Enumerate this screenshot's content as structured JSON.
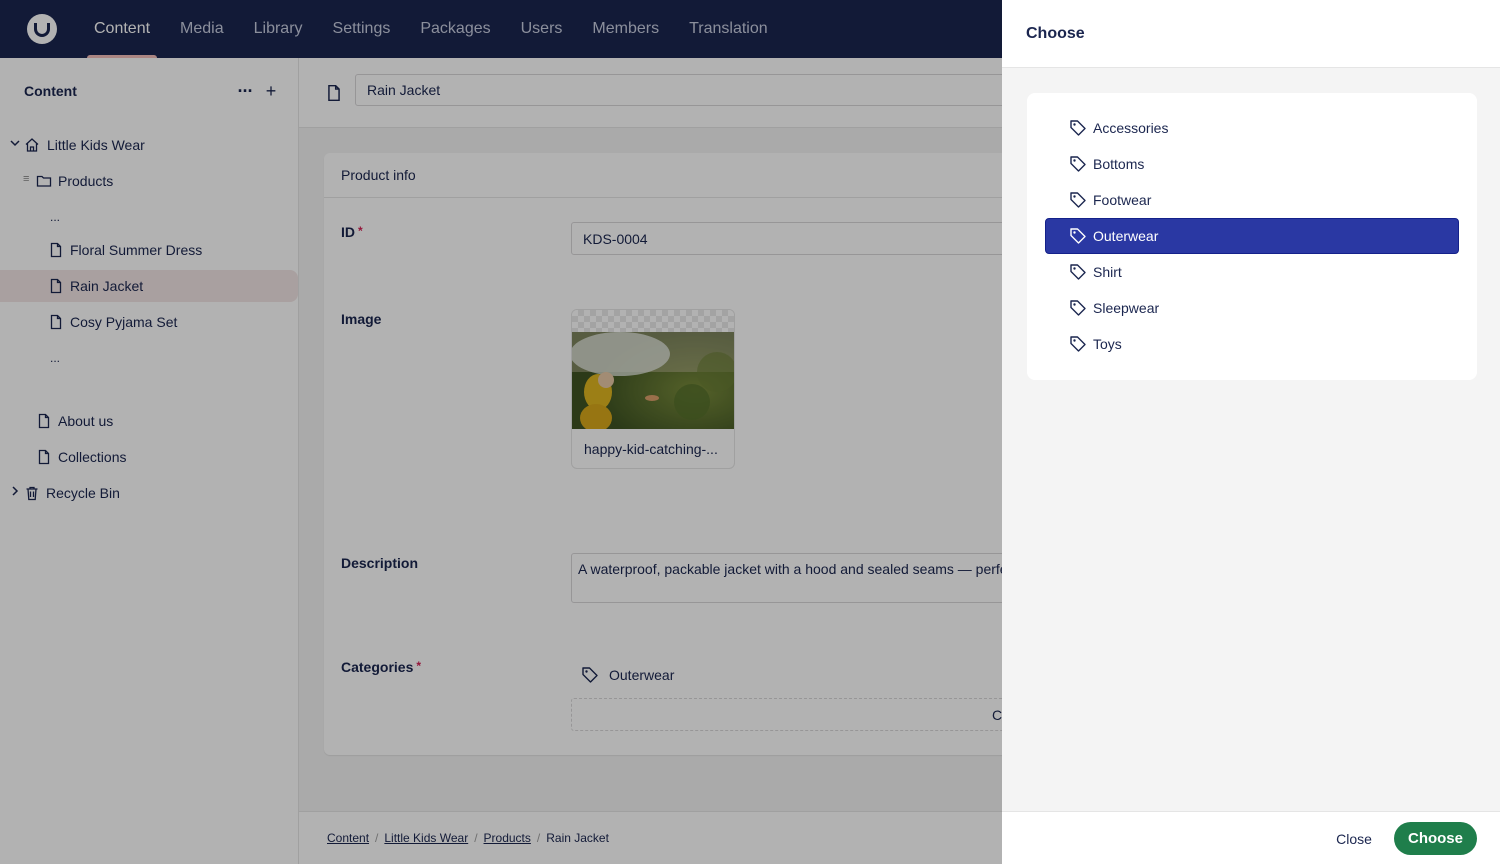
{
  "header": {
    "nav": [
      "Content",
      "Media",
      "Library",
      "Settings",
      "Packages",
      "Users",
      "Members",
      "Translation"
    ],
    "active": "Content"
  },
  "sidebar": {
    "title": "Content",
    "more_label": "···",
    "add_label": "+",
    "items": [
      {
        "label": "Little Kids Wear"
      },
      {
        "label": "Products"
      },
      {
        "label": "..."
      },
      {
        "label": "Floral Summer Dress"
      },
      {
        "label": "Rain Jacket"
      },
      {
        "label": "Cosy Pyjama Set"
      },
      {
        "label": "..."
      },
      {
        "label": "About us"
      },
      {
        "label": "Collections"
      },
      {
        "label": "Recycle Bin"
      }
    ]
  },
  "workspace": {
    "name": "Rain Jacket",
    "group_title": "Product info",
    "id_label": "ID",
    "id_value": "KDS-0004",
    "image_label": "Image",
    "image_name": "happy-kid-catching-...",
    "description_label": "Description",
    "description_value": "A waterproof, packable jacket with a hood and sealed seams — perfec",
    "categories_label": "Categories",
    "categories_selected": "Outerwear",
    "categories_button_partial": "C",
    "required_mark": "*"
  },
  "breadcrumbs": [
    "Content",
    "Little Kids Wear",
    "Products",
    "Rain Jacket"
  ],
  "modal": {
    "title": "Choose",
    "options": [
      "Accessories",
      "Bottoms",
      "Footwear",
      "Outerwear",
      "Shirt",
      "Sleepwear",
      "Toys"
    ],
    "selected": "Outerwear",
    "close_label": "Close",
    "choose_label": "Choose"
  },
  "colors": {
    "header_bg": "#1b264f",
    "selected_option": "#2a38a3",
    "choose_button": "#1f7e4b",
    "active_tab_indicator": "#f5c1bc"
  }
}
